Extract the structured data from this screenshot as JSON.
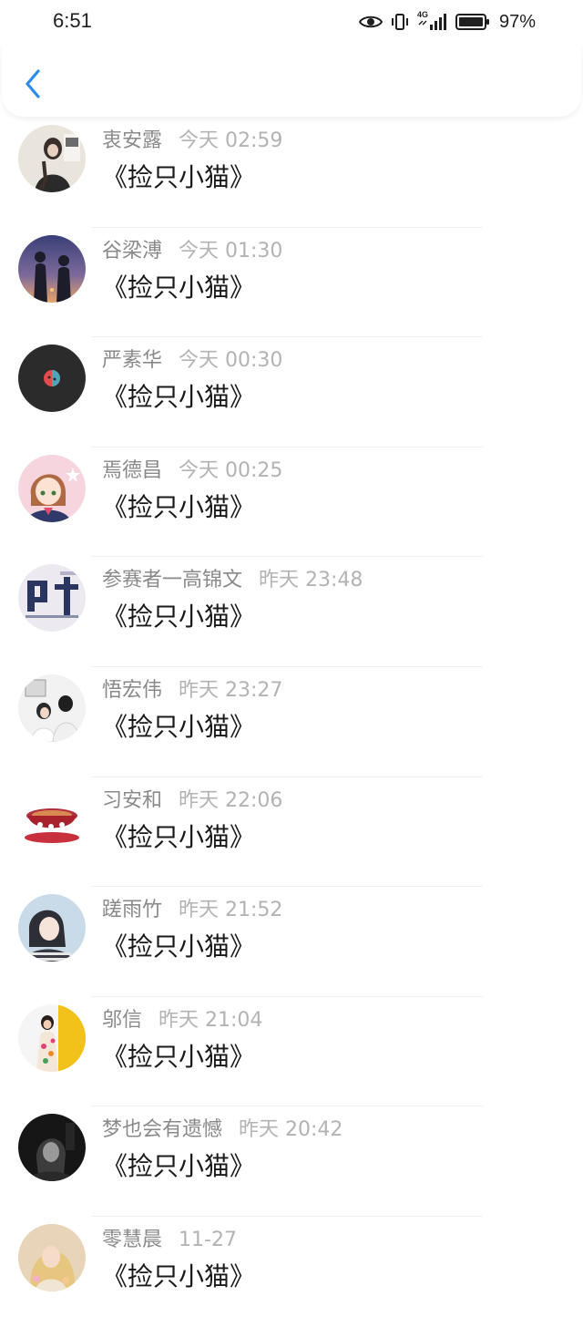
{
  "status_bar": {
    "time": "6:51",
    "network": "4G",
    "battery": "97%"
  },
  "header": {
    "back_icon": "chevron-left-icon",
    "accent_color": "#2b8de8"
  },
  "list": [
    {
      "name": "衷安露",
      "time": "今天 02:59",
      "message": "《捡只小猫》",
      "avatar": "girl-photo"
    },
    {
      "name": "谷梁溥",
      "time": "今天 01:30",
      "message": "《捡只小猫》",
      "avatar": "couple-silhouette"
    },
    {
      "name": "严素华",
      "time": "今天 00:30",
      "message": "《捡只小猫》",
      "avatar": "dark-logo"
    },
    {
      "name": "焉德昌",
      "time": "今天 00:25",
      "message": "《捡只小猫》",
      "avatar": "anime-girl"
    },
    {
      "name": "参赛者一高锦文",
      "time": "昨天 23:48",
      "message": "《捡只小猫》",
      "avatar": "text-graphic"
    },
    {
      "name": "悟宏伟",
      "time": "昨天 23:27",
      "message": "《捡只小猫》",
      "avatar": "couple-photo"
    },
    {
      "name": "习安和",
      "time": "昨天 22:06",
      "message": "《捡只小猫》",
      "avatar": "teacup"
    },
    {
      "name": "蹉雨竹",
      "time": "昨天 21:52",
      "message": "《捡只小猫》",
      "avatar": "girl-portrait"
    },
    {
      "name": "邬信",
      "time": "昨天 21:04",
      "message": "《捡只小猫》",
      "avatar": "flower-girl"
    },
    {
      "name": "梦也会有遗憾",
      "time": "昨天 20:42",
      "message": "《捡只小猫》",
      "avatar": "dark-portrait"
    },
    {
      "name": "零慧晨",
      "time": "11-27",
      "message": "《捡只小猫》",
      "avatar": "blonde-girl"
    }
  ]
}
